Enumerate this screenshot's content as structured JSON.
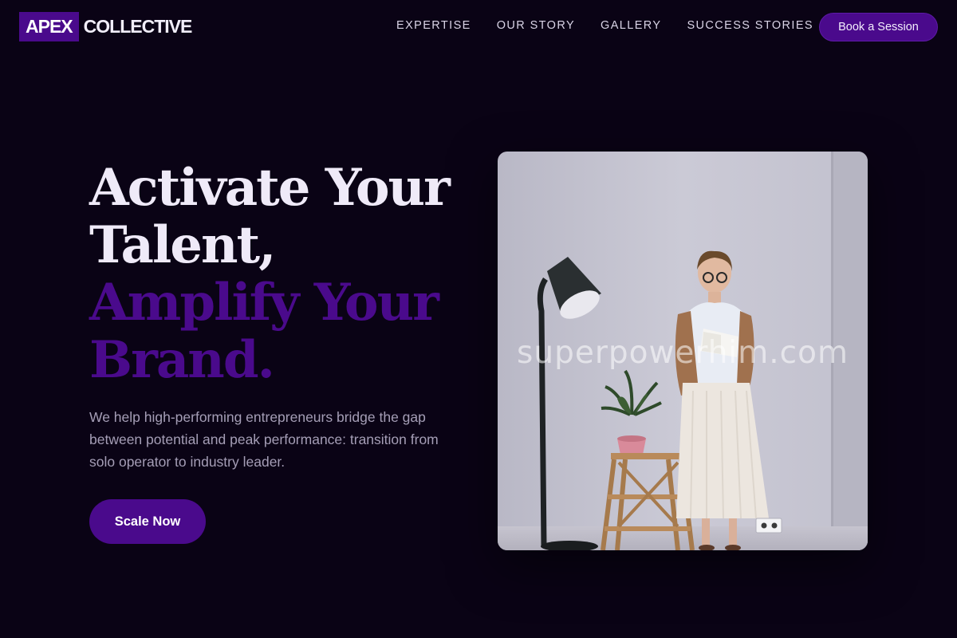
{
  "brand": {
    "logo_box": "APEX",
    "logo_text": "COLLECTIVE"
  },
  "nav": {
    "links": [
      "EXPERTISE",
      "OUR STORY",
      "GALLERY",
      "SUCCESS STORIES"
    ],
    "cta_label": "Book a Session"
  },
  "hero": {
    "title_lines": [
      "Activate Your",
      "Talent,",
      "Amplify Your",
      "Brand."
    ],
    "description": "We help high-performing entrepreneurs bridge the gap between potential and peak performance: transition from solo operator to industry leader.",
    "cta_label": "Scale Now"
  },
  "image": {
    "watermark": "superpowerhim.com",
    "subject": "woman with glasses holding an open book beside a floor lamp and a potted plant on a wooden step stool"
  },
  "colors": {
    "background": "#0a0315",
    "accent": "#4a0a8c",
    "heading": "#efeaf8",
    "body_text": "#a59eb6",
    "nav_text": "#d9d4e6"
  }
}
